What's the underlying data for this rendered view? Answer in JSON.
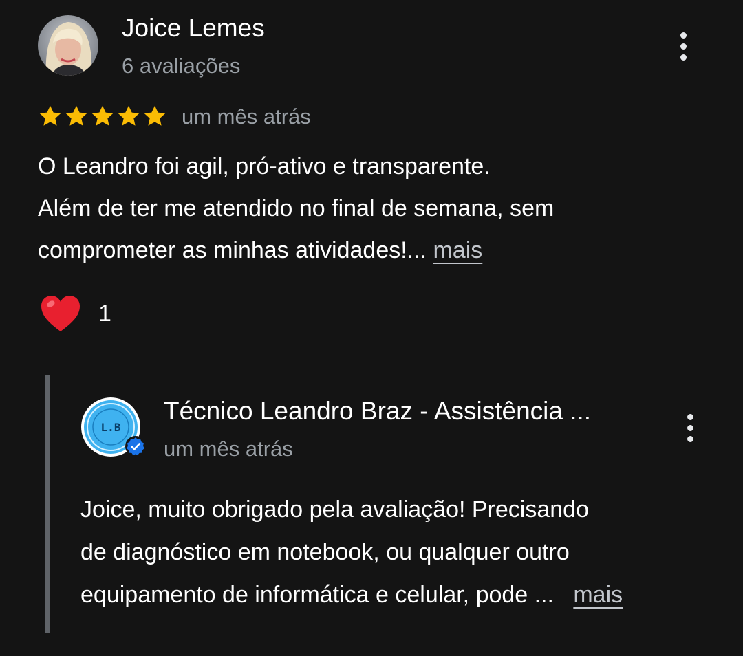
{
  "review": {
    "author_name": "Joice Lemes",
    "author_meta": "6 avaliações",
    "rating": 5,
    "max_rating": 5,
    "date": "um mês atrás",
    "text_lines": [
      "O Leandro foi agil, pró-ativo e transparente.",
      "Além de ter me atendido no final de semana, sem",
      "comprometer as minhas atividades!..."
    ],
    "more_label": "mais",
    "reaction_icon": "heart-icon",
    "reaction_count": "1",
    "menu_icon": "more-vert-icon"
  },
  "reply": {
    "owner_name": "Técnico Leandro Braz - Assistência ...",
    "owner_avatar_text": "L.B",
    "verified_icon": "verified-badge-icon",
    "date": "um mês atrás",
    "text_lines": [
      "Joice, muito obrigado pela avaliação! Precisando",
      "de diagnóstico em notebook, ou qualquer outro",
      "equipamento de informática e celular, pode ..."
    ],
    "more_label": "mais",
    "menu_icon": "more-vert-icon"
  },
  "colors": {
    "background": "#141414",
    "star": "#fbbc04",
    "heart": "#e8202f",
    "secondary_text": "#9aa0a6",
    "verified": "#1a73e8",
    "owner_avatar_bg": "#3fb2f0"
  }
}
